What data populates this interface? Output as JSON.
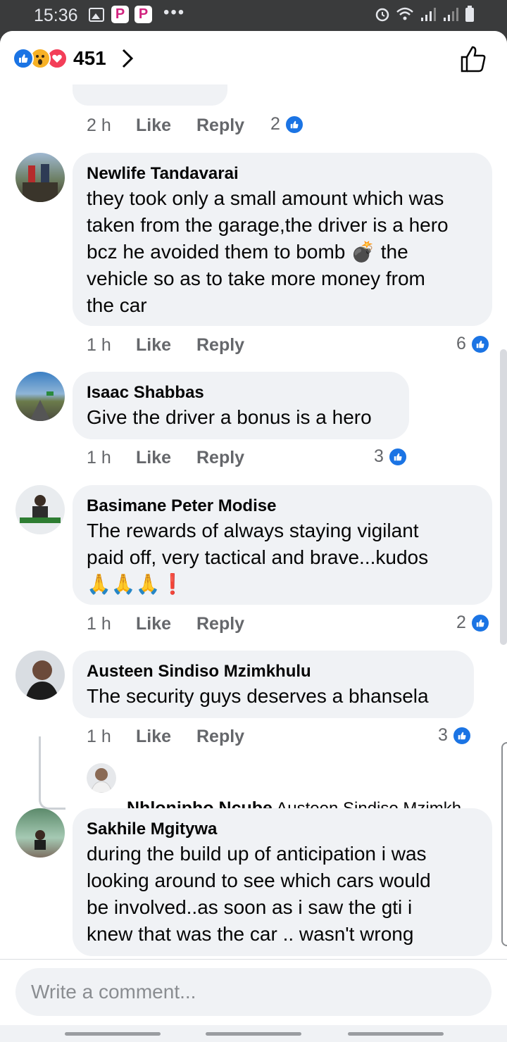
{
  "status_bar": {
    "time": "15:36",
    "dots": "•••"
  },
  "header": {
    "reaction_count": "451"
  },
  "truncated_comment": {
    "time": "2 h",
    "like": "Like",
    "reply": "Reply",
    "likes": "2"
  },
  "comments": [
    {
      "name": "Newlife Tandavarai",
      "lines": [
        "they took only a small amount which was",
        "taken from the garage,the driver is a hero",
        "bcz he avoided them to bomb 💣 the",
        "vehicle so as to take more money from",
        "the car"
      ],
      "time": "1 h",
      "like": "Like",
      "reply": "Reply",
      "likes": "6"
    },
    {
      "name": "Isaac Shabbas",
      "lines": [
        "Give the driver a bonus is a hero"
      ],
      "time": "1 h",
      "like": "Like",
      "reply": "Reply",
      "likes": "3"
    },
    {
      "name": "Basimane Peter Modise",
      "lines": [
        "The rewards of always staying vigilant",
        "paid off, very tactical and brave...kudos",
        "🙏🙏🙏❗"
      ],
      "time": "1 h",
      "like": "Like",
      "reply": "Reply",
      "likes": "2"
    },
    {
      "name": "Austeen Sindiso Mzimkhulu",
      "lines": [
        "The security guys deserves a bhansela"
      ],
      "time": "1 h",
      "like": "Like",
      "reply": "Reply",
      "likes": "3"
    },
    {
      "name": "Sakhile Mgitywa",
      "lines": [
        "during the build up of anticipation i was",
        "looking around to see which cars would",
        "be involved..as soon as i saw the gti i",
        "knew that was the car .. wasn't wrong"
      ]
    }
  ],
  "reply_preview": {
    "name": "Nhlonipho Ncube",
    "text": "Austeen Sindiso Mzimkh..."
  },
  "composer": {
    "placeholder": "Write a comment..."
  },
  "colors": {
    "facebook_blue": "#1b74e4",
    "bubble": "#f0f2f5",
    "meta_gray": "#65676b"
  }
}
